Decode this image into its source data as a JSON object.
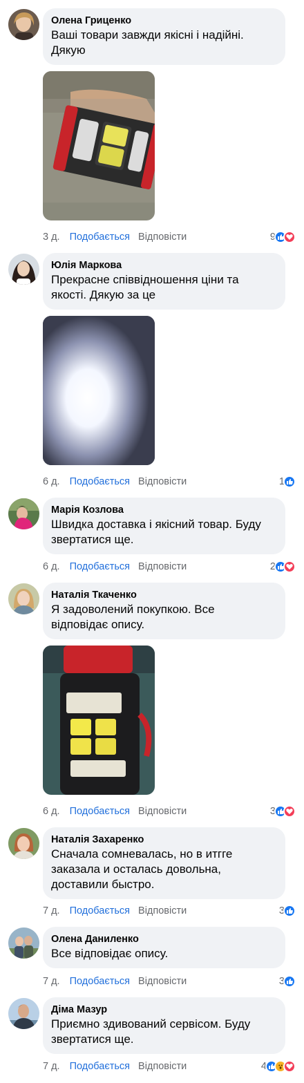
{
  "labels": {
    "like": "Подобається",
    "reply": "Відповісти"
  },
  "comments": [
    {
      "author": "Олена Гриценко",
      "text_lines": [
        "Ваші товари завжди якісні і надійні.",
        "Дякую"
      ],
      "time": "3 д.",
      "reaction_count": "9",
      "reactions": [
        "like-icon",
        "love-icon"
      ],
      "photo": "flashlight-photo-1"
    },
    {
      "author": "Юлія Маркова",
      "text_lines": [
        "Прекрасне співвідношення ціни та",
        "якості. Дякую за це"
      ],
      "time": "6 д.",
      "reaction_count": "1",
      "reactions": [
        "like-icon"
      ],
      "photo": "flashlight-photo-2"
    },
    {
      "author": "Марія Козлова",
      "text_lines": [
        "Швидка доставка і якісний товар. Буду",
        "звертатися ще."
      ],
      "time": "6 д.",
      "reaction_count": "2",
      "reactions": [
        "like-icon",
        "love-icon"
      ],
      "photo": null
    },
    {
      "author": "Наталія Ткаченко",
      "text_lines": [
        "Я задоволений покупкою. Все",
        "відповідає опису."
      ],
      "time": "6 д.",
      "reaction_count": "3",
      "reactions": [
        "like-icon",
        "love-icon"
      ],
      "photo": "flashlight-photo-3"
    },
    {
      "author": "Наталія Захаренко",
      "text_lines": [
        "Сначала сомневалась, но в итгге",
        "заказала и осталась довольна,",
        "доставили быстро."
      ],
      "time": "7 д.",
      "reaction_count": "3",
      "reactions": [
        "like-icon"
      ],
      "photo": null
    },
    {
      "author": "Олена Даниленко",
      "text_lines": [
        "Все відповідає опису."
      ],
      "time": "7 д.",
      "reaction_count": "3",
      "reactions": [
        "like-icon"
      ],
      "photo": null
    },
    {
      "author": "Діма Мазур",
      "text_lines": [
        "Приємно здивований сервісом. Буду",
        "звертатися ще."
      ],
      "time": "7 д.",
      "reaction_count": "4",
      "reactions": [
        "like-icon",
        "wow-icon",
        "love-icon"
      ],
      "photo": null
    }
  ],
  "colors": {
    "bubble": "#f0f2f5",
    "link": "#216fdb",
    "muted": "#65676b",
    "like": "#1877f2",
    "love": "#f33e58",
    "wow": "#f7b125"
  }
}
